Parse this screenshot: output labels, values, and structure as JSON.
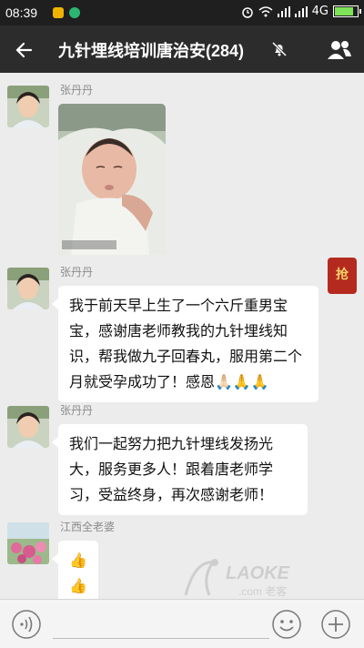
{
  "status": {
    "time": "08:39",
    "network": "4G"
  },
  "header": {
    "title": "九针埋线培训唐治安(284)"
  },
  "messages": [
    {
      "sender": "张丹丹",
      "type": "image"
    },
    {
      "sender": "张丹丹",
      "type": "text",
      "text": "我于前天早上生了一个六斤重男宝宝，感谢唐老师教我的九针埋线知识，帮我做九子回春丸，服用第二个月就受孕成功了！感恩🙏🏻🙏🙏"
    },
    {
      "sender": "张丹丹",
      "type": "text",
      "text": "我们一起努力把九针埋线发扬光大，服务更多人！跟着唐老师学习，受益终身，再次感谢老师！"
    },
    {
      "sender": "江西全老婆",
      "type": "text",
      "text": "👍👍👍"
    }
  ],
  "red_packet": {
    "label": "抢"
  },
  "watermark": {
    "text": "LAOKE",
    "sub": ".com 老客"
  },
  "colors": {
    "titlebar": "#2c2c2c",
    "chat_bg": "#ececec",
    "bubble": "#ffffff",
    "red_packet": "#b52a1e"
  }
}
